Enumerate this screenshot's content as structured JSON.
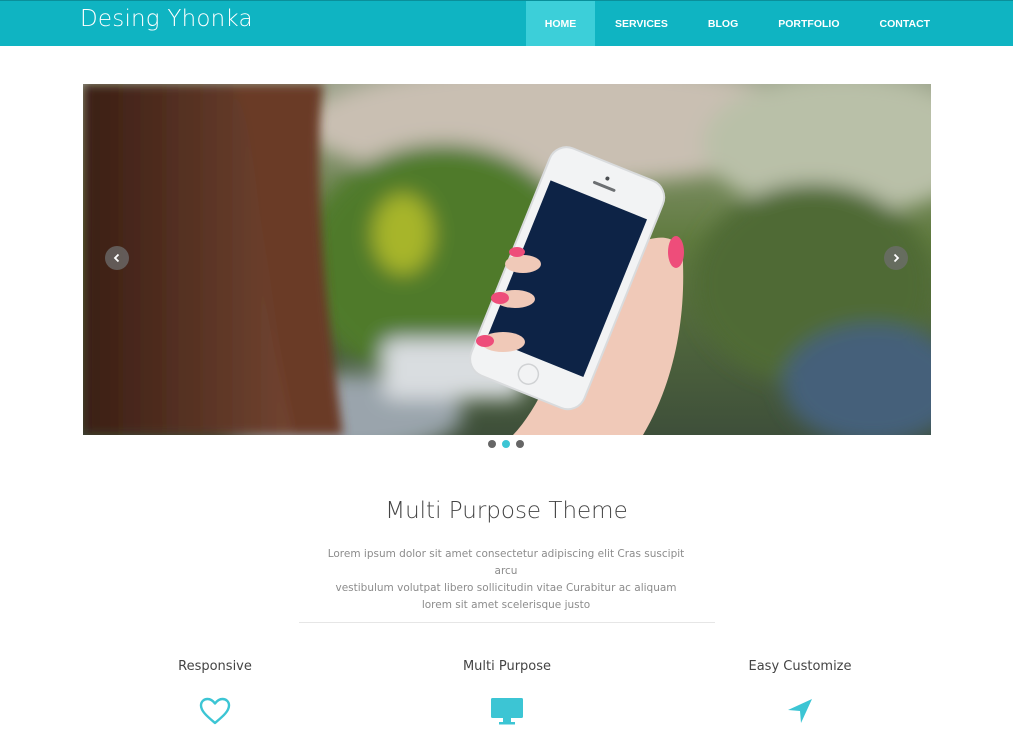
{
  "header": {
    "brand": "Desing Yhonka",
    "nav": [
      {
        "label": "HOME",
        "active": true
      },
      {
        "label": "SERVICES",
        "active": false
      },
      {
        "label": "BLOG",
        "active": false
      },
      {
        "label": "PORTFOLIO",
        "active": false
      },
      {
        "label": "CONTACT",
        "active": false
      }
    ]
  },
  "slider": {
    "active_slide": 2,
    "slide_count": 3
  },
  "intro": {
    "title": "Multi Purpose Theme",
    "text_line1": "Lorem ipsum dolor sit amet consectetur adipiscing elit Cras suscipit arcu",
    "text_line2": "vestibulum volutpat libero sollicitudin vitae Curabitur ac aliquam",
    "text_line3": "lorem sit amet scelerisque justo"
  },
  "features": [
    {
      "title": "Responsive",
      "icon": "heart-icon"
    },
    {
      "title": "Multi Purpose",
      "icon": "monitor-icon"
    },
    {
      "title": "Easy Customize",
      "icon": "navigation-arrow-icon"
    }
  ],
  "colors": {
    "brand": "#0fb4c2",
    "nav_active": "#3ccfd9",
    "accent": "#3cc5d4"
  }
}
